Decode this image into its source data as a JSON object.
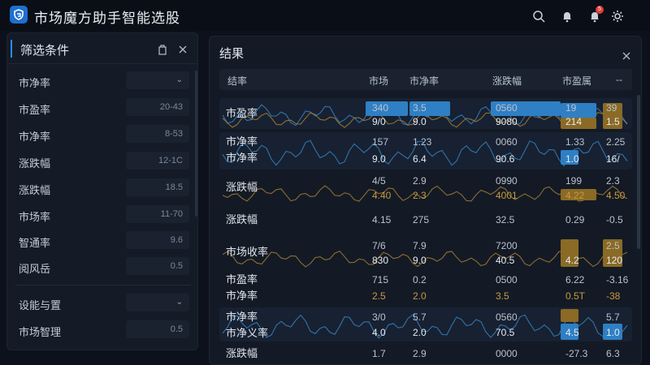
{
  "app": {
    "title": "市场魔方助手智能选股",
    "notification_count": "5"
  },
  "filter": {
    "title": "筛选条件",
    "rows": [
      {
        "label": "市净率",
        "value": ""
      },
      {
        "label": "市盈率",
        "value": "20-43"
      },
      {
        "label": "市净率",
        "value": "8-53"
      },
      {
        "label": "涨跌幅",
        "value": "12-1C"
      },
      {
        "label": "涨跌幅",
        "value": "18.5"
      },
      {
        "label": "市场率",
        "value": "11-70"
      },
      {
        "label": "智通率",
        "value": "9.6"
      },
      {
        "label": "阅风岳",
        "value": "0.5"
      }
    ],
    "section2": [
      {
        "label": "设能与置",
        "value": ""
      },
      {
        "label": "市场智理",
        "value": "0.5"
      }
    ]
  },
  "results": {
    "title": "结果",
    "headers": [
      "结率",
      "市场",
      "市净率",
      "涨跌幅",
      "市盈属",
      "--"
    ],
    "rows": [
      {
        "name": [
          "市盈率"
        ],
        "c1": [
          "340",
          "9/0"
        ],
        "c2": [
          "3.5",
          "9.0"
        ],
        "c3": [
          "0560",
          "9080"
        ],
        "c4": [
          "19",
          "214"
        ],
        "c5": [
          "39",
          "1.5"
        ]
      },
      {
        "name": [
          "市净率",
          "市净率"
        ],
        "c1": [
          "157",
          "9.0"
        ],
        "c2": [
          "1.23",
          "6.4"
        ],
        "c3": [
          "0060",
          "90.6"
        ],
        "c4": [
          "1.33",
          "1.0"
        ],
        "c5": [
          "2.25",
          "16/"
        ]
      },
      {
        "name": [
          "涨跌幅"
        ],
        "c1": [
          "4/5",
          "4.40"
        ],
        "c2": [
          "2.9",
          "2.3"
        ],
        "c3": [
          "0990",
          "4001"
        ],
        "c4": [
          "199",
          "4.22"
        ],
        "c5": [
          "2.3",
          "4.50"
        ]
      },
      {
        "name": [
          "涨跌幅"
        ],
        "c1": [
          "4.15",
          ""
        ],
        "c2": [
          "275",
          ""
        ],
        "c3": [
          "32.5",
          ""
        ],
        "c4": [
          "0.29",
          ""
        ],
        "c5": [
          "-0.5",
          ""
        ]
      },
      {
        "name": [
          "市场收率"
        ],
        "c1": [
          "7/6",
          "830"
        ],
        "c2": [
          "7.9",
          "9.0"
        ],
        "c3": [
          "7200",
          "40.5"
        ],
        "c4": [
          "",
          "4.2"
        ],
        "c5": [
          "2.5",
          "120"
        ]
      },
      {
        "name": [
          "市盈率",
          "市净率"
        ],
        "c1": [
          "715",
          "2.5"
        ],
        "c2": [
          "0.2",
          "2.0"
        ],
        "c3": [
          "0500",
          "3.5"
        ],
        "c4": [
          "6.22",
          "0.5T"
        ],
        "c5": [
          "-3.16",
          "-38"
        ]
      },
      {
        "name": [
          "市净率",
          "市净义率"
        ],
        "c1": [
          "3/0",
          "4.0"
        ],
        "c2": [
          "5.7",
          "2.0"
        ],
        "c3": [
          "0560",
          "70.5"
        ],
        "c4": [
          "",
          "4.5"
        ],
        "c5": [
          "5.7",
          "1.0"
        ]
      },
      {
        "name": [
          "涨跌幅"
        ],
        "c1": [
          "1.7",
          ""
        ],
        "c2": [
          "2.9",
          ""
        ],
        "c3": [
          "0000",
          ""
        ],
        "c4": [
          "-27.3",
          ""
        ],
        "c5": [
          "6.3",
          ""
        ]
      }
    ]
  },
  "colors": {
    "accent": "#2e8ae6",
    "blue_fill": "#2f7fc4",
    "gold_fill": "#8a6a25",
    "gold_text": "#c69a3f"
  },
  "icons": [
    "logo-icon",
    "search-icon",
    "bell-icon",
    "notification-icon",
    "settings-icon",
    "copy-icon",
    "close-icon",
    "chevron-down-icon"
  ]
}
